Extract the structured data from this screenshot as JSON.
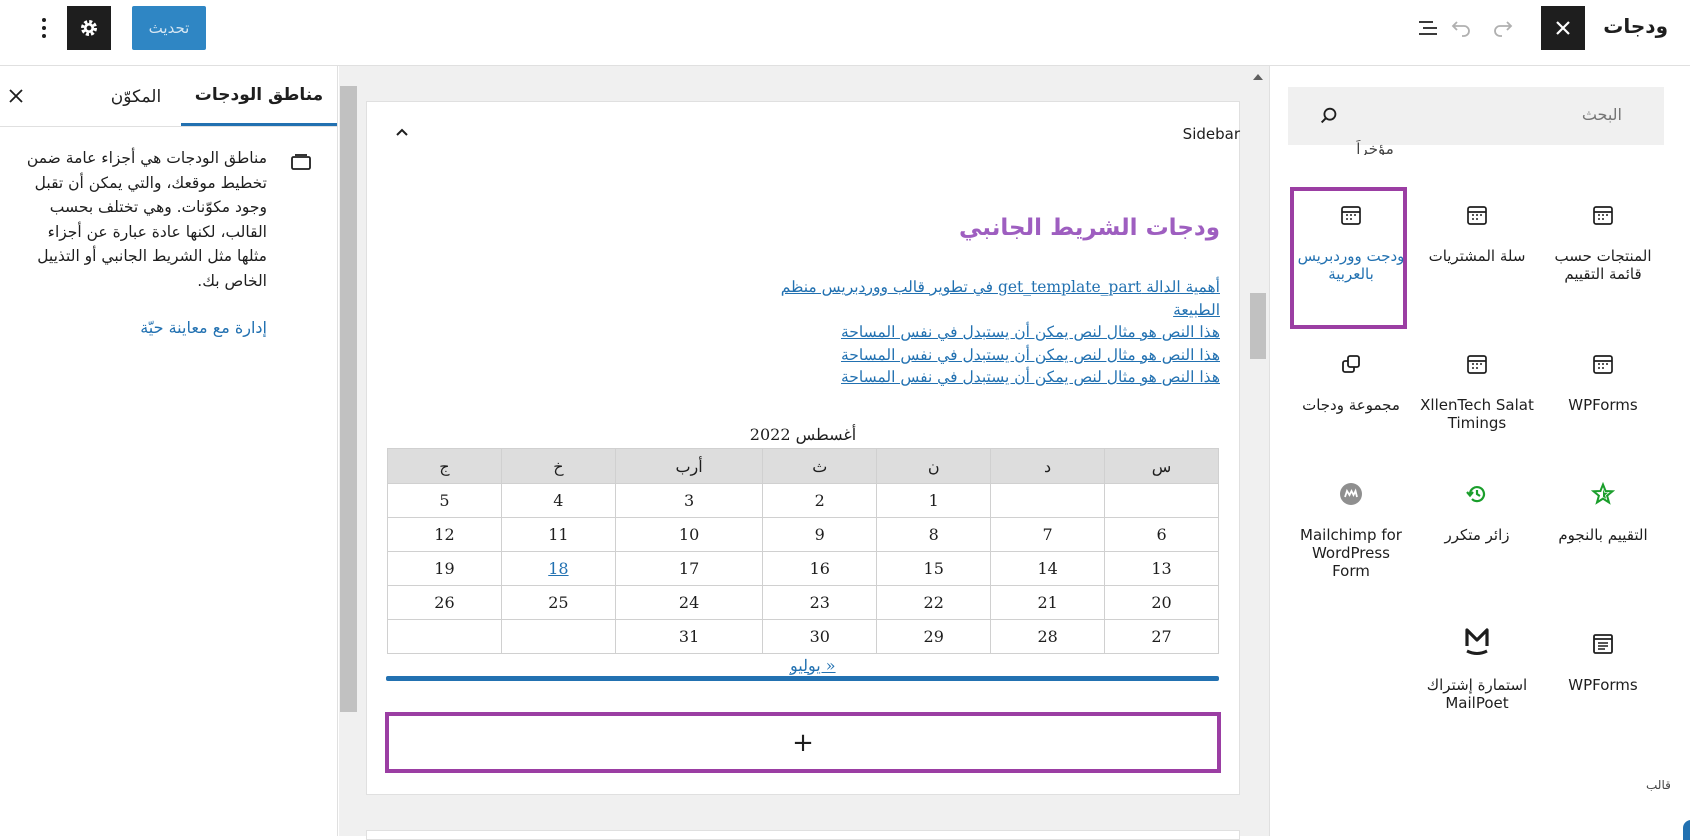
{
  "header": {
    "title": "ودجات",
    "update_label": "تحديث"
  },
  "settings_panel": {
    "tab_widget_areas": "مناطق الودجات",
    "tab_block": "المكوّن",
    "description": "مناطق الودجات هي أجزاء عامة ضمن تخطيط موقعك، والتي يمكن أن تقبل وجود مكوّنات. وهي تختلف بحسب القالب، لكنها عادة عبارة عن أجزاء مثلها مثل الشريط الجانبي أو التذييل الخاص بك.",
    "manage_link": "إدارة مع معاينة حيّة"
  },
  "canvas": {
    "area_label": "Sidebar",
    "widget_title": "ودجات الشريط الجانبي",
    "links": [
      "أهمية الدالة get_template_part في تطوير قالب ووردبريس منظم الطبيعة",
      "هذا النص هو مثال لنص يمكن أن يستبدل في نفس المساحة",
      "هذا النص هو مثال لنص يمكن أن يستبدل في نفس المساحة",
      "هذا النص هو مثال لنص يمكن أن يستبدل في نفس المساحة"
    ],
    "calendar": {
      "caption": "أغسطس 2022",
      "weekdays": [
        "س",
        "د",
        "ن",
        "ث",
        "أرب",
        "خ",
        "ج"
      ],
      "weeks": [
        [
          "",
          "",
          "1",
          "2",
          "3",
          "4",
          "5"
        ],
        [
          "6",
          "7",
          "8",
          "9",
          "10",
          "11",
          "12"
        ],
        [
          "13",
          "14",
          "15",
          "16",
          "17",
          "18",
          "19"
        ],
        [
          "20",
          "21",
          "22",
          "23",
          "24",
          "25",
          "26"
        ],
        [
          "27",
          "28",
          "29",
          "30",
          "31",
          "",
          ""
        ]
      ],
      "linked_day": "18",
      "prev_link": "« يوليو"
    },
    "add_block_symbol": "+"
  },
  "inserter": {
    "search_placeholder": "البحث",
    "recent_cut_label": "مؤخراً",
    "blocks": [
      {
        "label": "المنتجات حسب قائمة التقييم",
        "icon": "calendar-icon"
      },
      {
        "label": "سلة المشتريات",
        "icon": "calendar-icon"
      },
      {
        "label": "ودجت ووردبريس بالعربية",
        "icon": "calendar-icon"
      },
      {
        "label": "WPForms",
        "icon": "calendar-icon"
      },
      {
        "label": "XllenTech Salat Timings",
        "icon": "calendar-icon"
      },
      {
        "label": "مجموعة ودجات",
        "icon": "widget-group-icon"
      },
      {
        "label": "التقييم بالنجوم",
        "icon": "star-icon"
      },
      {
        "label": "زائر متكرر",
        "icon": "history-icon"
      },
      {
        "label": "Mailchimp for WordPress Form",
        "icon": "mailchimp-icon"
      },
      {
        "label": "WPForms",
        "icon": "form-icon"
      },
      {
        "label": "استمارة إشتراك MailPoet",
        "icon": "mailpoet-icon"
      }
    ],
    "more_label": "قالب"
  },
  "colors": {
    "accent": "#2271b1",
    "selection": "#9b3ea3",
    "widget_title": "#9e5ec0",
    "star": "#1a9e2b",
    "history": "#1a9e2b"
  }
}
